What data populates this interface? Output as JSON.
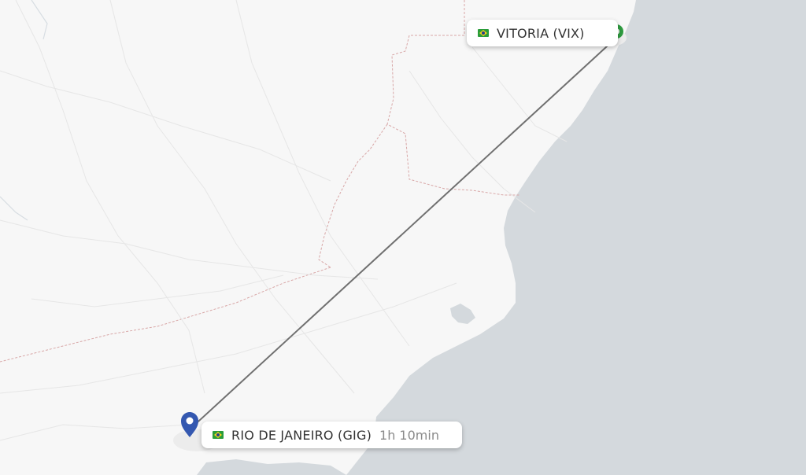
{
  "map": {
    "colors": {
      "land": "#f7f7f7",
      "sea": "#d4d9dd",
      "route": "#707070",
      "origin_marker": "#3458b0",
      "destination_marker": "#2e9b3f"
    },
    "origin": {
      "label": "RIO DE JANEIRO (GIG)",
      "duration": "1h 10min",
      "flag_icon": "brazil-flag-icon",
      "marker_icon": "map-pin-icon"
    },
    "destination": {
      "label": "VITORIA (VIX)",
      "flag_icon": "brazil-flag-icon",
      "marker_icon": "map-pin-icon"
    }
  }
}
